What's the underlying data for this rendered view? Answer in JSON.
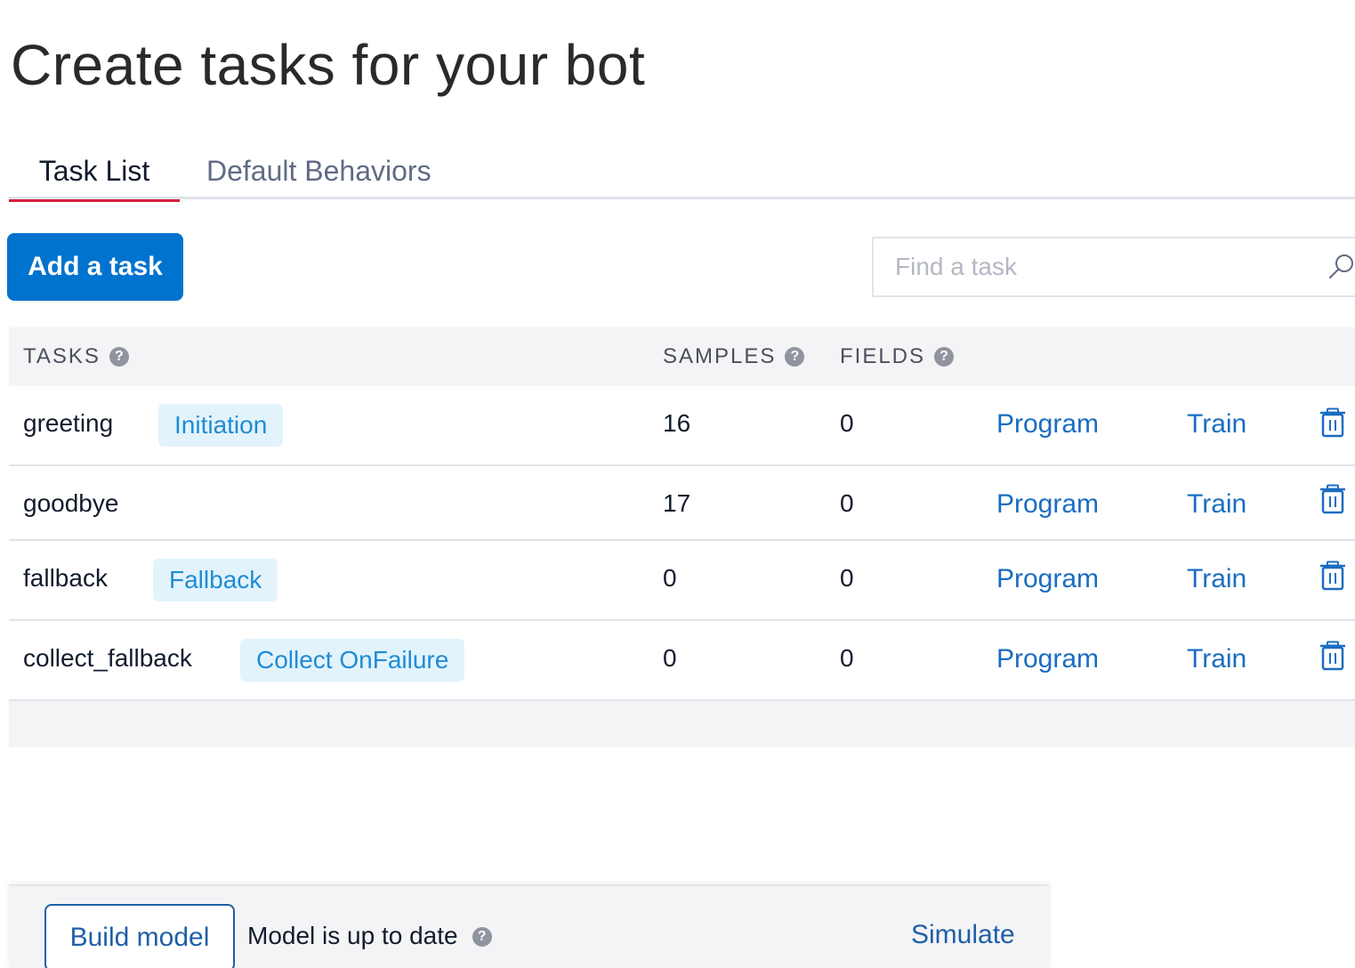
{
  "page": {
    "title": "Create tasks for your bot"
  },
  "tabs": [
    {
      "label": "Task List",
      "active": true
    },
    {
      "label": "Default Behaviors",
      "active": false
    }
  ],
  "toolbar": {
    "add_task_label": "Add a task",
    "search_placeholder": "Find a task",
    "search_value": ""
  },
  "table": {
    "headers": {
      "tasks": "TASKS",
      "samples": "SAMPLES",
      "fields": "FIELDS"
    },
    "help_glyph": "?",
    "rows": [
      {
        "name": "greeting",
        "tag": "Initiation",
        "samples": "16",
        "fields": "0",
        "program": "Program",
        "train": "Train"
      },
      {
        "name": "goodbye",
        "tag": "",
        "samples": "17",
        "fields": "0",
        "program": "Program",
        "train": "Train"
      },
      {
        "name": "fallback",
        "tag": "Fallback",
        "samples": "0",
        "fields": "0",
        "program": "Program",
        "train": "Train"
      },
      {
        "name": "collect_fallback",
        "tag": "Collect OnFailure",
        "samples": "0",
        "fields": "0",
        "program": "Program",
        "train": "Train"
      }
    ]
  },
  "bottom_bar": {
    "build_label": "Build model",
    "status_text": "Model is up to date",
    "simulate_label": "Simulate"
  },
  "colors": {
    "primary": "#0073cf",
    "link": "#1a6dc2",
    "tab_active_underline": "#d61f3c",
    "tag_bg": "#e3f3fc",
    "tag_text": "#1f8cd6"
  },
  "icons": {
    "search": "search-icon",
    "help": "help-icon",
    "delete": "trash-icon"
  }
}
